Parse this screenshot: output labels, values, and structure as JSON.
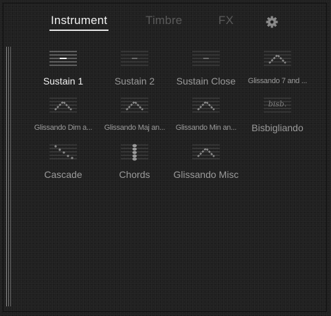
{
  "tabs": [
    {
      "label": "Instrument",
      "active": true
    },
    {
      "label": "Timbre",
      "active": false
    },
    {
      "label": "FX",
      "active": false
    }
  ],
  "settings_icon": "gear-icon",
  "presets": [
    {
      "label": "Sustain 1",
      "icon": "sustain-icon",
      "selected": true
    },
    {
      "label": "Sustain 2",
      "icon": "sustain-icon",
      "selected": false
    },
    {
      "label": "Sustain Close",
      "icon": "sustain-icon",
      "selected": false
    },
    {
      "label": "Glissando 7 and ...",
      "icon": "glissando-icon",
      "selected": false
    },
    {
      "label": "Glissando Dim a...",
      "icon": "glissando-icon",
      "selected": false
    },
    {
      "label": "Glissando Maj an...",
      "icon": "glissando-icon",
      "selected": false
    },
    {
      "label": "Glissando Min an...",
      "icon": "glissando-icon",
      "selected": false
    },
    {
      "label": "Bisbigliando",
      "icon": "bisbigliando-icon",
      "icon_text": "bisb.",
      "selected": false
    },
    {
      "label": "Cascade",
      "icon": "cascade-icon",
      "selected": false
    },
    {
      "label": "Chords",
      "icon": "chords-icon",
      "selected": false
    },
    {
      "label": "Glissando Misc",
      "icon": "glissando-icon",
      "selected": false
    }
  ],
  "colors": {
    "background": "#202020",
    "active_text": "#f0f0f0",
    "inactive_tab": "#5a5a5a",
    "label_text": "#9a9a9a"
  }
}
